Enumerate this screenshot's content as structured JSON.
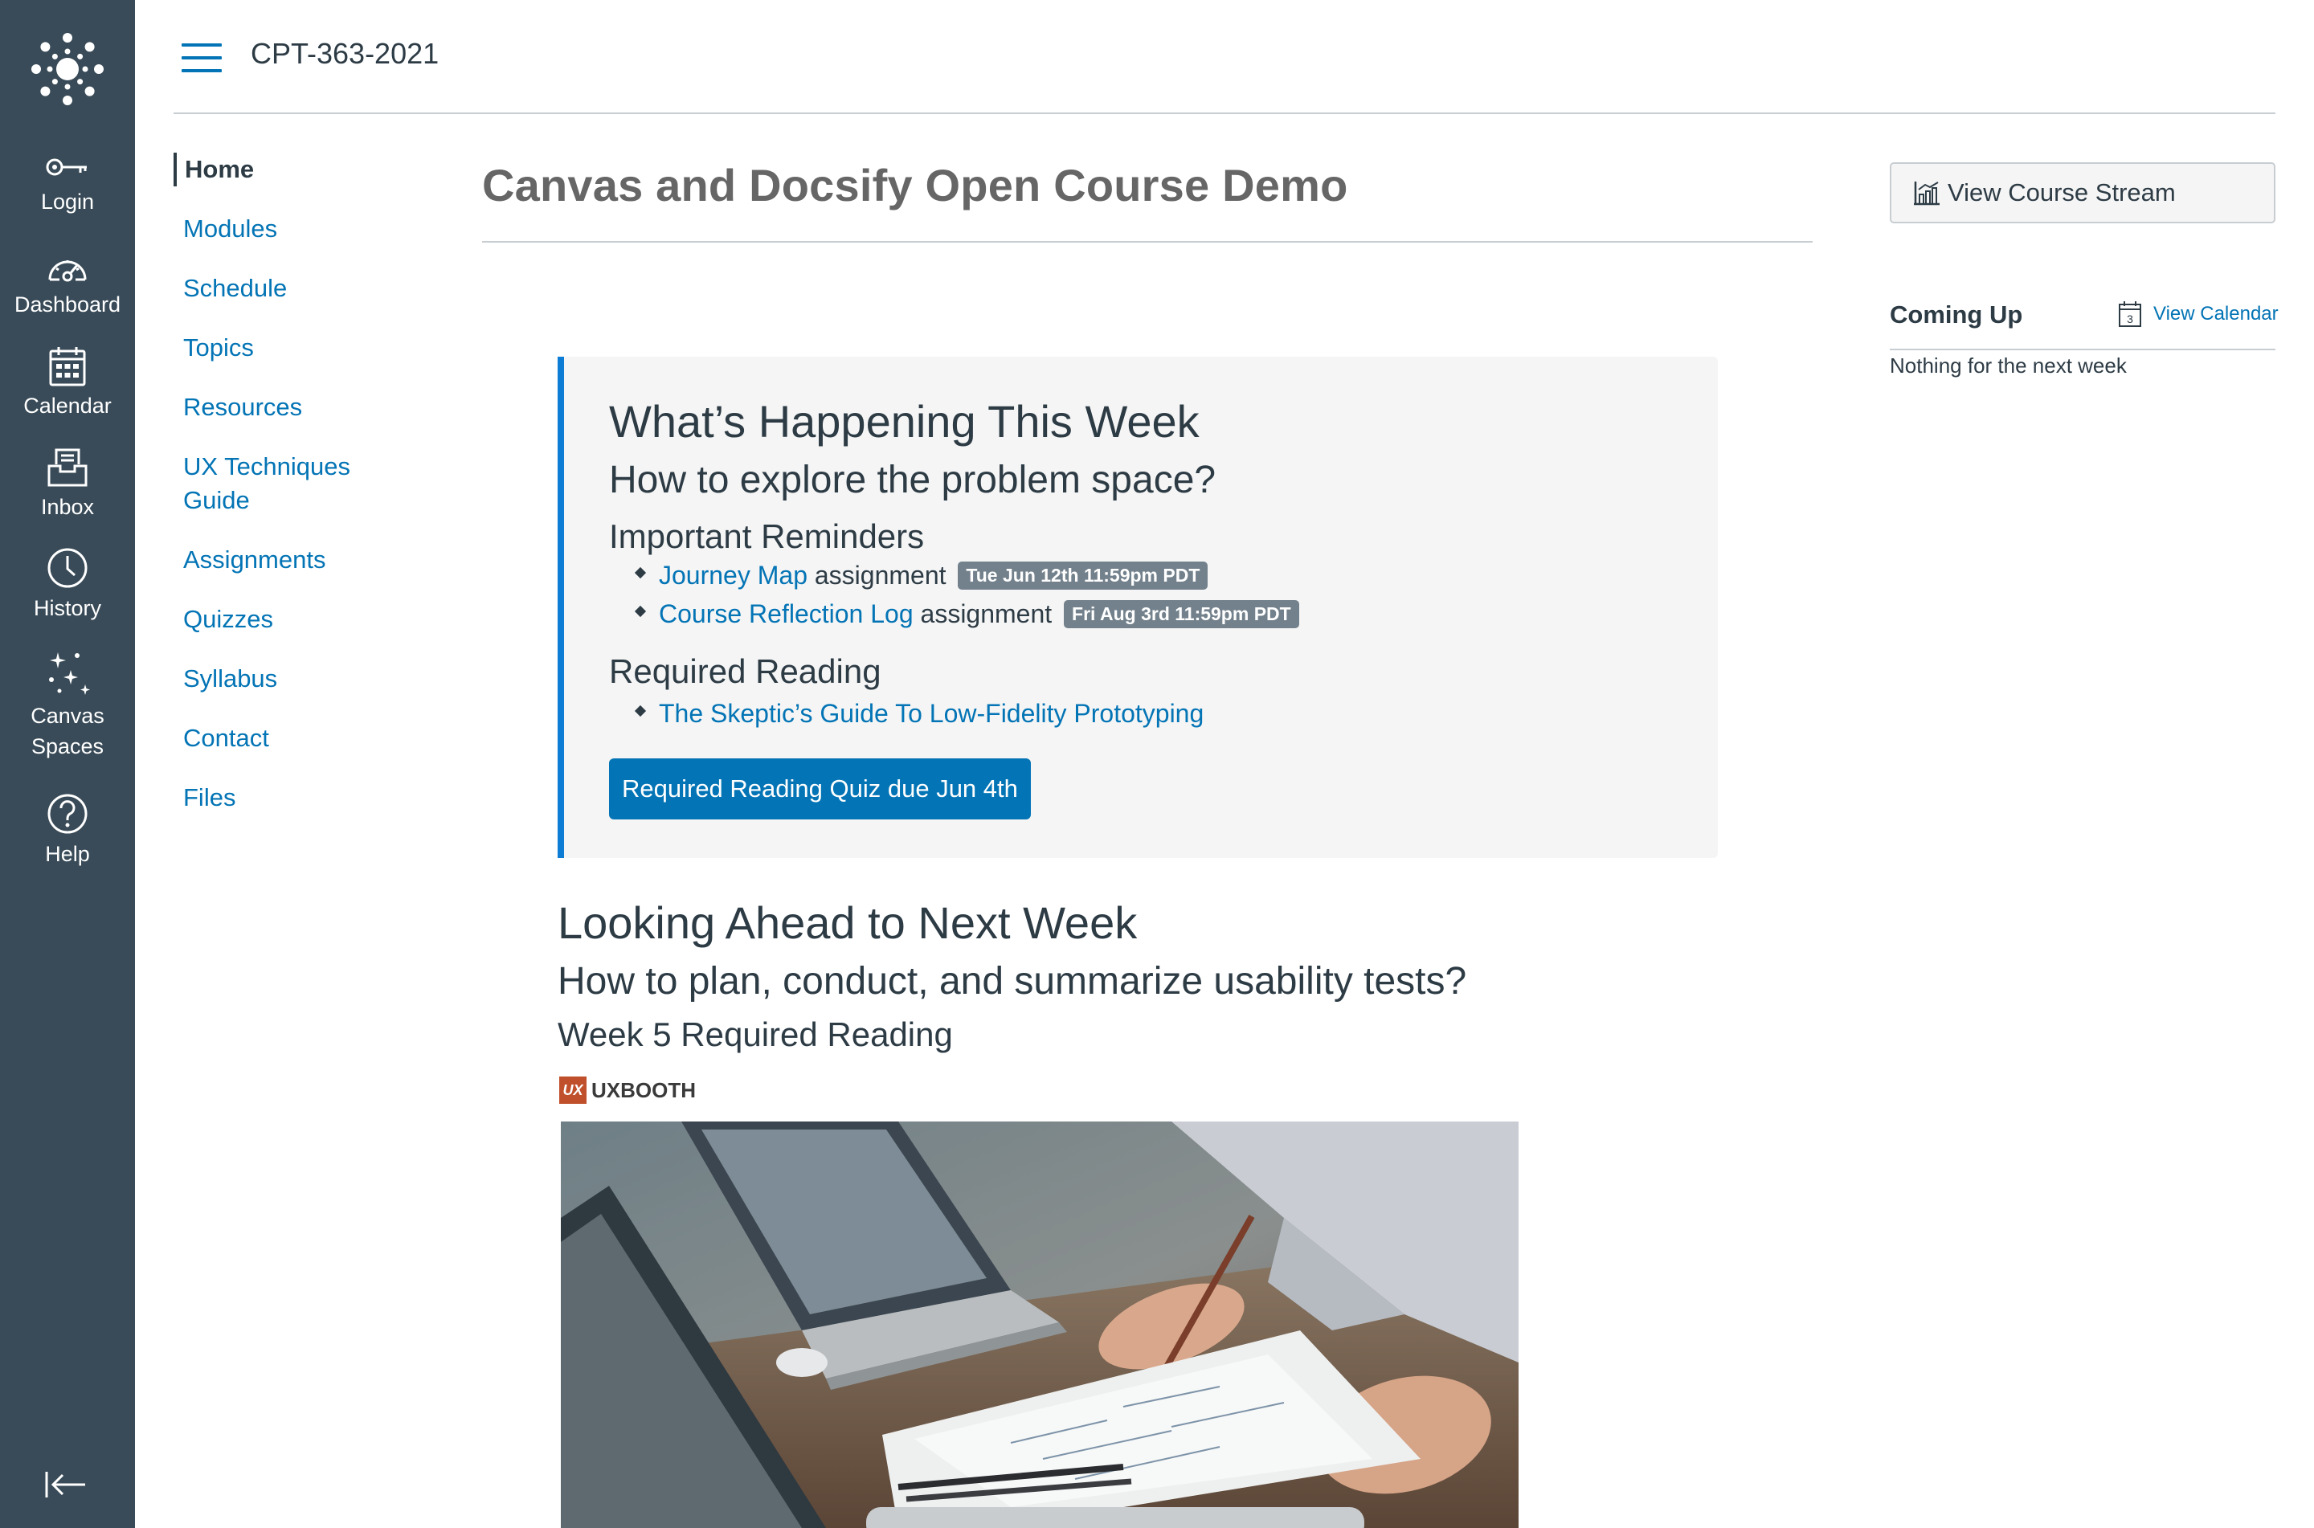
{
  "global_nav": {
    "items": [
      {
        "label": "Login",
        "icon": "key-icon"
      },
      {
        "label": "Dashboard",
        "icon": "dashboard-icon"
      },
      {
        "label": "Calendar",
        "icon": "calendar-icon"
      },
      {
        "label": "Inbox",
        "icon": "inbox-icon"
      },
      {
        "label": "History",
        "icon": "clock-icon"
      },
      {
        "label": "Canvas Spaces",
        "icon": "sparkles-icon"
      },
      {
        "label": "Help",
        "icon": "help-icon"
      }
    ],
    "collapse_icon": "collapse-arrow-icon"
  },
  "header": {
    "breadcrumb": "CPT-363-2021"
  },
  "course_nav": {
    "items": [
      {
        "label": "Home",
        "active": true
      },
      {
        "label": "Modules"
      },
      {
        "label": "Schedule"
      },
      {
        "label": "Topics"
      },
      {
        "label": "Resources"
      },
      {
        "label": "UX Techniques Guide"
      },
      {
        "label": "Assignments"
      },
      {
        "label": "Quizzes"
      },
      {
        "label": "Syllabus"
      },
      {
        "label": "Contact"
      },
      {
        "label": "Files"
      }
    ]
  },
  "main": {
    "title": "Canvas and Docsify Open Course Demo",
    "this_week": {
      "heading": "What’s Happening This Week",
      "question": "How to explore the problem space?",
      "reminders_heading": "Important Reminders",
      "reminders": [
        {
          "link": "Journey Map",
          "text": "assignment",
          "due": "Tue Jun 12th 11:59pm PDT"
        },
        {
          "link": "Course Reflection Log",
          "text": "assignment",
          "due": "Fri Aug 3rd 11:59pm PDT"
        }
      ],
      "reading_heading": "Required Reading",
      "readings": [
        {
          "link": "The Skeptic’s Guide To Low-Fidelity Prototyping"
        }
      ],
      "quiz_button": "Required Reading Quiz due Jun 4th"
    },
    "next_week": {
      "heading": "Looking Ahead to Next Week",
      "question": "How to plan, conduct, and summarize usability tests?",
      "reading_heading": "Week 5 Required Reading",
      "source_mark": "UX",
      "source": "UXBOOTH"
    }
  },
  "sidebar": {
    "stream_button": "View Course Stream",
    "coming_up_heading": "Coming Up",
    "view_calendar": "View Calendar",
    "calendar_day": "3",
    "coming_up_empty": "Nothing for the next week"
  },
  "colors": {
    "nav_bg": "#394b58",
    "link": "#0374b5",
    "callout_border": "#0c7cd5",
    "badge_bg": "#73818c"
  }
}
